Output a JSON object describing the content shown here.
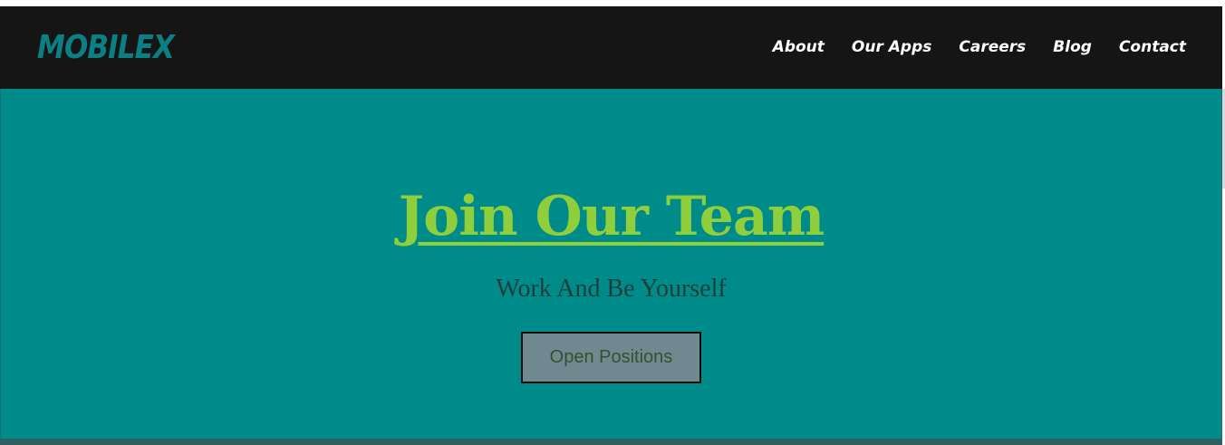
{
  "header": {
    "logo": "MOBILEX",
    "nav": [
      {
        "label": "About"
      },
      {
        "label": "Our Apps"
      },
      {
        "label": "Careers"
      },
      {
        "label": "Blog"
      },
      {
        "label": "Contact"
      }
    ]
  },
  "hero": {
    "title": "Join Our Team",
    "subtitle": "Work And Be Yourself",
    "button_label": "Open Positions"
  },
  "colors": {
    "navbar_bg": "#151515",
    "hero_bg": "#008b8b",
    "logo": "#0b7f83",
    "title": "#8fcf3c",
    "button_bg": "#708890"
  }
}
